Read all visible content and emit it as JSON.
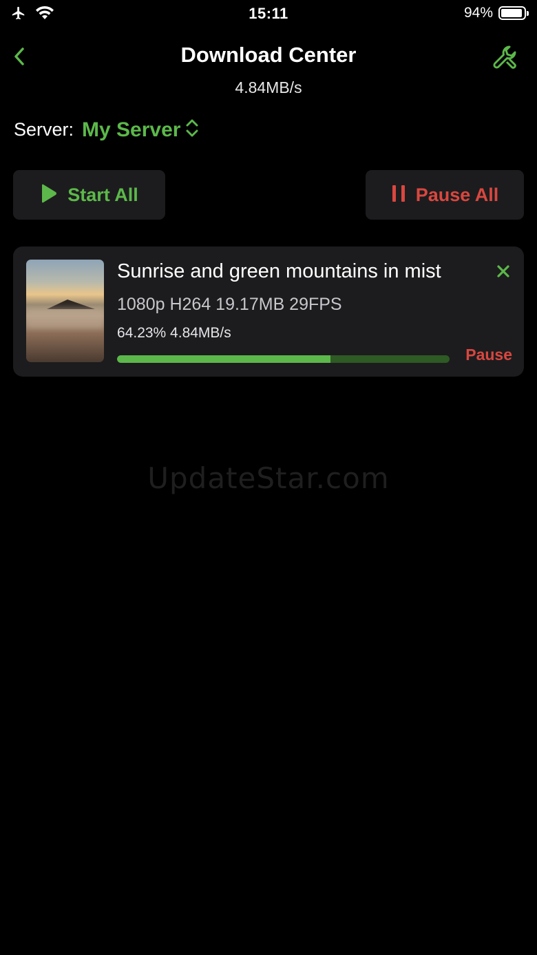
{
  "status_bar": {
    "time": "15:11",
    "battery_percent": "94%",
    "battery_level": 0.94,
    "icons": [
      "airplane-icon",
      "wifi-icon",
      "battery-icon"
    ]
  },
  "nav": {
    "title": "Download Center",
    "speed": "4.84MB/s",
    "back_icon": "chevron-left-icon",
    "tools_icon": "wrench-icon"
  },
  "server": {
    "label": "Server:",
    "value": "My Server",
    "icon": "chevron-up-down-icon"
  },
  "actions": {
    "start_all": "Start All",
    "pause_all": "Pause All"
  },
  "downloads": [
    {
      "title": "Sunrise and green mountains in mist",
      "meta": "1080p H264 19.17MB 29FPS",
      "progress_text": "64.23%  4.84MB/s",
      "progress": 0.6423,
      "action_label": "Pause"
    }
  ],
  "watermark": "UpdateStar.com",
  "colors": {
    "accent_green": "#5cb84a",
    "accent_red": "#d9473f",
    "card_bg": "#1c1c1e",
    "background": "#000000"
  }
}
